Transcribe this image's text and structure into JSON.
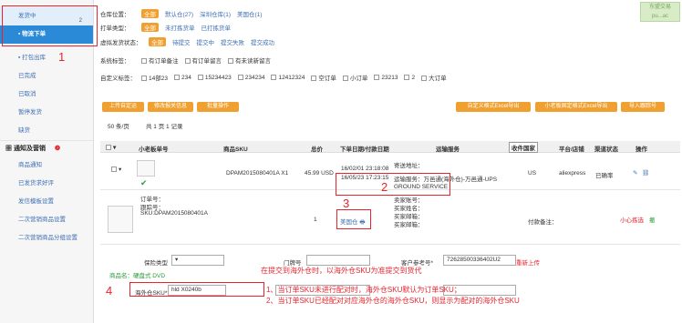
{
  "sidebar": {
    "top_item": "发货中",
    "top_badge": "2",
    "active_item": "物流下单",
    "items": [
      "打包出库",
      "已完成",
      "已取消",
      "暂停发货",
      "缺货"
    ],
    "section_title": "通知及营销",
    "section_items": [
      "商品通知",
      "已发货求好评",
      "发信模板设置",
      "二次营销商品设置",
      "二次营销商品分组设置"
    ]
  },
  "filters": {
    "warehouse": {
      "label": "仓库位置：",
      "options": [
        "全部",
        "默认仓(27)",
        "深圳仓库(1)",
        "美国仓(1)"
      ]
    },
    "print_type": {
      "label": "打单类型：",
      "options": [
        "全部",
        "未打拣货单",
        "已打拣货单"
      ]
    },
    "virtual_status": {
      "label": "虚拟发货状态：",
      "options": [
        "全部",
        "待提交",
        "提交中",
        "提交失败",
        "提交成功"
      ]
    },
    "system_tag": {
      "label": "系统标签：",
      "options": [
        "有订单备注",
        "有订单留言",
        "有未读新留言"
      ]
    },
    "custom_tag": {
      "label": "自定义标签：",
      "options": [
        "14部23",
        "234",
        "15234423",
        "234234",
        "12412324",
        "空订单",
        "小订单",
        "23213",
        "2",
        "大订单"
      ]
    }
  },
  "toolbar": {
    "left_buttons": [
      "上传自定运",
      "修改报关信息",
      "批量操作"
    ],
    "right_buttons": [
      "自定义格式Excel导出",
      "小老板固定格式Excel导出",
      "导入跟踪号"
    ],
    "page_info": "50 条/页",
    "page_total": "共 1 页 1 记录"
  },
  "table": {
    "headers": [
      "小老板单号",
      "商品SKU",
      "总价",
      "下单日期/付款日期",
      "运输服务",
      "收件国家",
      "平台/店铺",
      "渠道状态",
      "操作"
    ],
    "country_select": "收件国家",
    "row": {
      "sku": "DPAM2015080401A X1",
      "price": "45.99 USD",
      "order_date": "16/02/01 23:18:08",
      "pay_date": "16/05/23 17:23:15",
      "service_label": "寄送地址：",
      "service": "运输服务：万邑通(海外仓)-万邑通-UPS GROUND SERVICE",
      "country": "US",
      "platform": "aliexpress",
      "status": "已确率"
    },
    "detail": {
      "order_no": "订单号：",
      "tracking": "跟踪号：",
      "sku_line": "SKU:DPAM2015080401A",
      "qty": "1",
      "warehouse": "美国仓",
      "buyer_labels": [
        "卖家账号：",
        "买家姓名：",
        "买家邮箱：",
        "买家邮箱："
      ],
      "pay_info": "付款备注：",
      "action_link": "小心拣选",
      "action_side": "撤"
    }
  },
  "form": {
    "insurance_label": "保险类型",
    "door_label": "门牌号",
    "ref_label": "客户参考号*",
    "ref_value": "72628500336402U2",
    "reupload": "重新上传",
    "product_name": "商品名：硬盘式 DVD",
    "overseas_sku_label": "海外仓SKU*",
    "overseas_sku_value": "hld X0240b"
  },
  "annotations": {
    "n1": "1",
    "n2": "2",
    "n3": "3",
    "n4": "4",
    "note_main": "在提交到海外仓时，以海外仓SKU为准提交到货代",
    "note_1": "1、当订单SKU未进行配对时，海外仓SKU默认为订单SKU；",
    "note_2": "2、当订单SKU已经配对对应海外仓的海外仓SKU，则显示为配对的海外仓SKU"
  },
  "logo": {
    "line1": "东盟交易",
    "line2": "pu...ac"
  }
}
